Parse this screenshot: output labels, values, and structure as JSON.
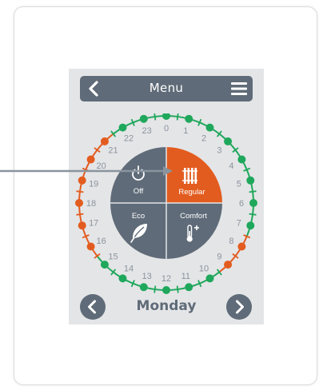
{
  "header": {
    "title": "Menu"
  },
  "dial": {
    "modes": [
      {
        "id": "off",
        "label": "Off",
        "icon": "power-icon"
      },
      {
        "id": "regular",
        "label": "Regular",
        "icon": "radiator-icon"
      },
      {
        "id": "eco",
        "label": "Eco",
        "icon": "leaf-icon"
      },
      {
        "id": "comfort",
        "label": "Comfort",
        "icon": "thermometer-plus-icon"
      }
    ],
    "selected_mode": "regular",
    "hours": [
      "0",
      "1",
      "2",
      "3",
      "4",
      "5",
      "6",
      "7",
      "8",
      "9",
      "10",
      "11",
      "12",
      "13",
      "14",
      "15",
      "16",
      "17",
      "18",
      "19",
      "20",
      "21",
      "22",
      "23"
    ],
    "schedule": [
      "green",
      "green",
      "green",
      "green",
      "green",
      "green",
      "green",
      "green",
      "orange",
      "orange",
      "green",
      "green",
      "green",
      "green",
      "green",
      "green",
      "orange",
      "orange",
      "orange",
      "orange",
      "orange",
      "orange",
      "green",
      "green"
    ]
  },
  "day_nav": {
    "day": "Monday"
  },
  "colors": {
    "accent_orange": "#e35c1f",
    "eco_green": "#1fa85c",
    "slate": "#5f6b78",
    "panel_bg": "#e4e5e7"
  }
}
